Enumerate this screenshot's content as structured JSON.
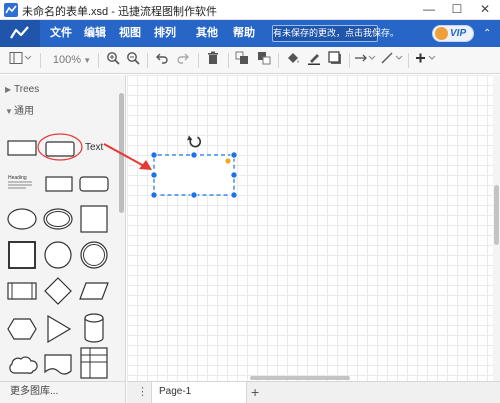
{
  "window": {
    "title": "未命名的表单.xsd - 迅捷流程图制作软件",
    "minimize": "—",
    "maximize": "☐",
    "close": "✕"
  },
  "menubar": {
    "items": [
      "文件",
      "编辑",
      "视图",
      "排列",
      "其他",
      "帮助"
    ],
    "save_notice": "有未保存的更改，点击我保存。",
    "vip_label": "VIP",
    "collapse": "⌃"
  },
  "toolbar": {
    "zoom_level": "100%"
  },
  "sidebar": {
    "sections": [
      {
        "label": "Trees",
        "expanded": false
      },
      {
        "label": "通用",
        "expanded": true
      }
    ],
    "text_shape_label": "Text",
    "heading_shape_title": "Heading",
    "more_libraries": "更多图库..."
  },
  "pages": {
    "tabs": [
      "Page-1"
    ],
    "add_label": "+",
    "menu_label": "⋮"
  },
  "colors": {
    "menubar": "#2765c7",
    "selection": "#1a73e8",
    "annotation": "#e53935",
    "rotate_handle": "#333333",
    "edit_handle": "#f5a623"
  },
  "icons": [
    "app-icon",
    "logo-icon",
    "format-panel-icon",
    "zoom-in-icon",
    "zoom-out-icon",
    "undo-icon",
    "redo-icon",
    "delete-icon",
    "to-front-icon",
    "to-back-icon",
    "fill-color-icon",
    "line-color-icon",
    "shadow-icon",
    "connection-icon",
    "waypoint-icon",
    "insert-icon",
    "rotate-icon"
  ]
}
